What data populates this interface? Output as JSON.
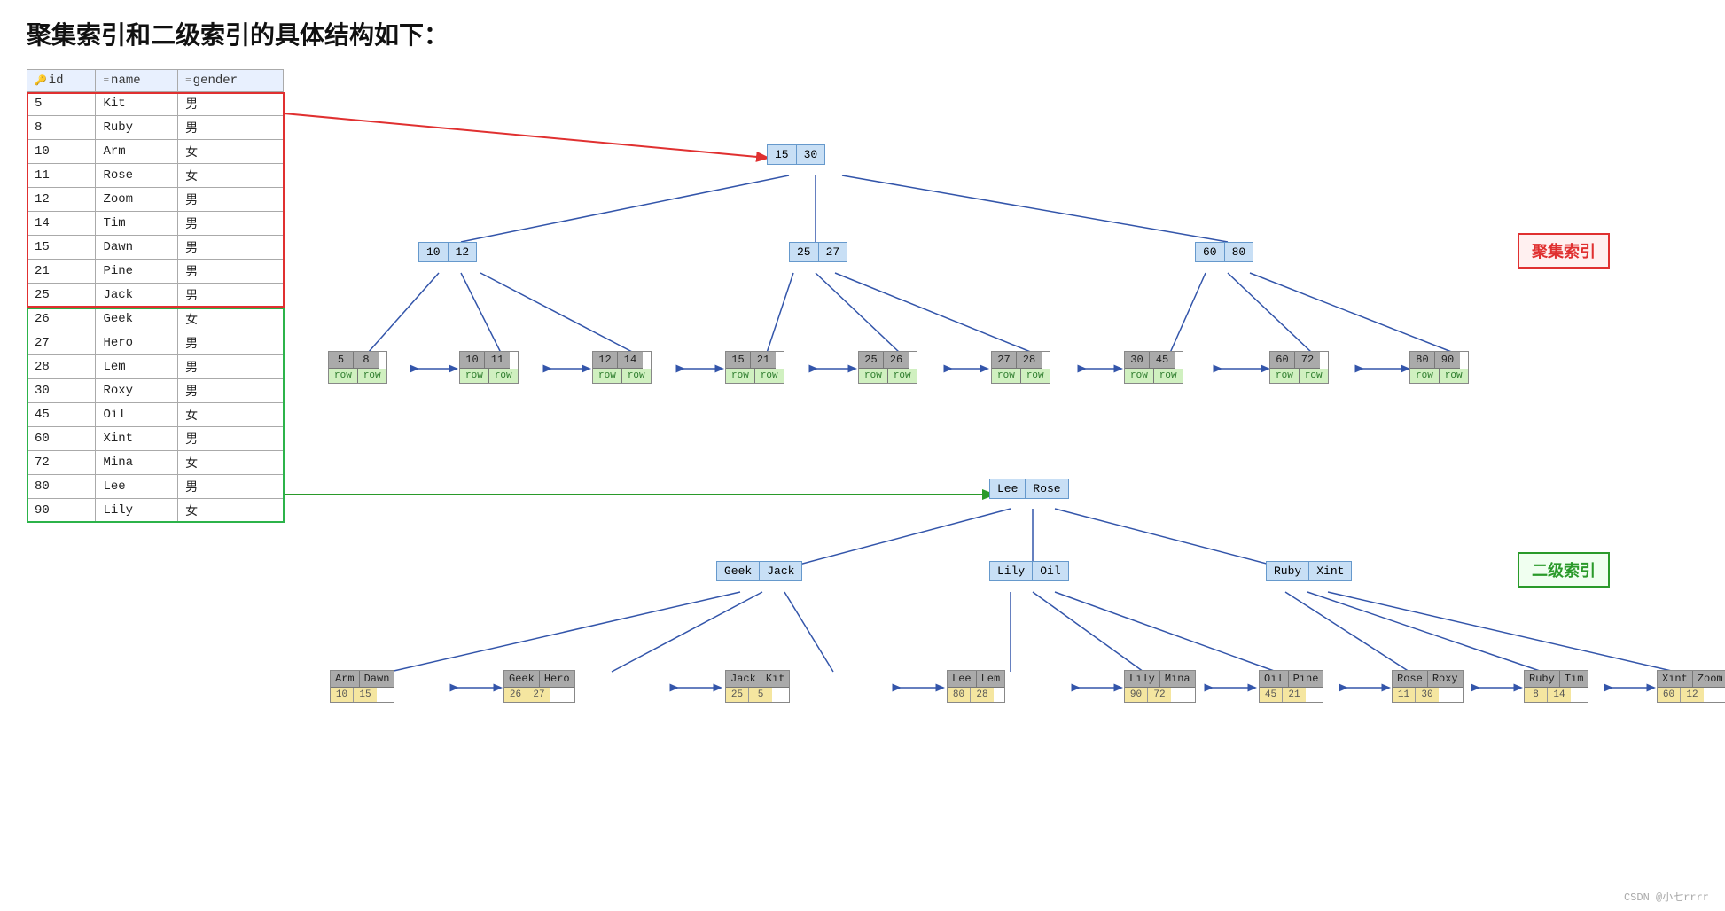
{
  "title": "聚集索引和二级索引的具体结构如下：",
  "table": {
    "headers": [
      "id",
      "name",
      "gender"
    ],
    "rows": [
      [
        "5",
        "Kit",
        "男"
      ],
      [
        "8",
        "Ruby",
        "男"
      ],
      [
        "10",
        "Arm",
        "女"
      ],
      [
        "11",
        "Rose",
        "女"
      ],
      [
        "12",
        "Zoom",
        "男"
      ],
      [
        "14",
        "Tim",
        "男"
      ],
      [
        "15",
        "Dawn",
        "男"
      ],
      [
        "21",
        "Pine",
        "男"
      ],
      [
        "25",
        "Jack",
        "男"
      ],
      [
        "26",
        "Geek",
        "女"
      ],
      [
        "27",
        "Hero",
        "男"
      ],
      [
        "28",
        "Lem",
        "男"
      ],
      [
        "30",
        "Roxy",
        "男"
      ],
      [
        "45",
        "Oil",
        "女"
      ],
      [
        "60",
        "Xint",
        "男"
      ],
      [
        "72",
        "Mina",
        "女"
      ],
      [
        "80",
        "Lee",
        "男"
      ],
      [
        "90",
        "Lily",
        "女"
      ]
    ]
  },
  "clustered_label": "聚集索引",
  "secondary_label": "二级索引",
  "watermark": "CSDN @小七rrrr",
  "clustered_root": {
    "vals": [
      "15",
      "30"
    ]
  },
  "clustered_l2_left": {
    "vals": [
      "10",
      "12"
    ]
  },
  "clustered_l2_mid": {
    "vals": [
      "25",
      "27"
    ]
  },
  "clustered_l2_right": {
    "vals": [
      "60",
      "80"
    ]
  },
  "clustered_leaves": [
    {
      "header": [
        "5",
        "8"
      ],
      "body": [
        "row",
        "row"
      ]
    },
    {
      "header": [
        "10",
        "11"
      ],
      "body": [
        "row",
        "row"
      ]
    },
    {
      "header": [
        "12",
        "14"
      ],
      "body": [
        "row",
        "row"
      ]
    },
    {
      "header": [
        "15",
        "21"
      ],
      "body": [
        "row",
        "row"
      ]
    },
    {
      "header": [
        "25",
        "26"
      ],
      "body": [
        "row",
        "row"
      ]
    },
    {
      "header": [
        "27",
        "28"
      ],
      "body": [
        "row",
        "row"
      ]
    },
    {
      "header": [
        "30",
        "45"
      ],
      "body": [
        "row",
        "row"
      ]
    },
    {
      "header": [
        "60",
        "72"
      ],
      "body": [
        "row",
        "row"
      ]
    },
    {
      "header": [
        "80",
        "90"
      ],
      "body": [
        "row",
        "row"
      ]
    }
  ],
  "secondary_root": {
    "vals": [
      "Lee",
      "Rose"
    ]
  },
  "secondary_l2_left": {
    "vals": [
      "Geek",
      "Jack"
    ]
  },
  "secondary_l2_mid": {
    "vals": [
      "Lily",
      "Oil"
    ]
  },
  "secondary_l2_right": {
    "vals": [
      "Ruby",
      "Xint"
    ]
  },
  "secondary_leaves": [
    {
      "header": [
        "Arm",
        "Dawn"
      ],
      "body": [
        "10",
        "15"
      ]
    },
    {
      "header": [
        "Geek",
        "Hero"
      ],
      "body": [
        "26",
        "27"
      ]
    },
    {
      "header": [
        "Jack",
        "Kit"
      ],
      "body": [
        "25",
        "5"
      ]
    },
    {
      "header": [
        "Lee",
        "Lem"
      ],
      "body": [
        "80",
        "28"
      ]
    },
    {
      "header": [
        "Lily",
        "Mina"
      ],
      "body": [
        "90",
        "72"
      ]
    },
    {
      "header": [
        "Oil",
        "Pine"
      ],
      "body": [
        "45",
        "21"
      ]
    },
    {
      "header": [
        "Rose",
        "Roxy"
      ],
      "body": [
        "11",
        "30"
      ]
    },
    {
      "header": [
        "Ruby",
        "Tim"
      ],
      "body": [
        "8",
        "14"
      ]
    },
    {
      "header": [
        "Xint",
        "Zoom"
      ],
      "body": [
        "60",
        "12"
      ]
    }
  ]
}
